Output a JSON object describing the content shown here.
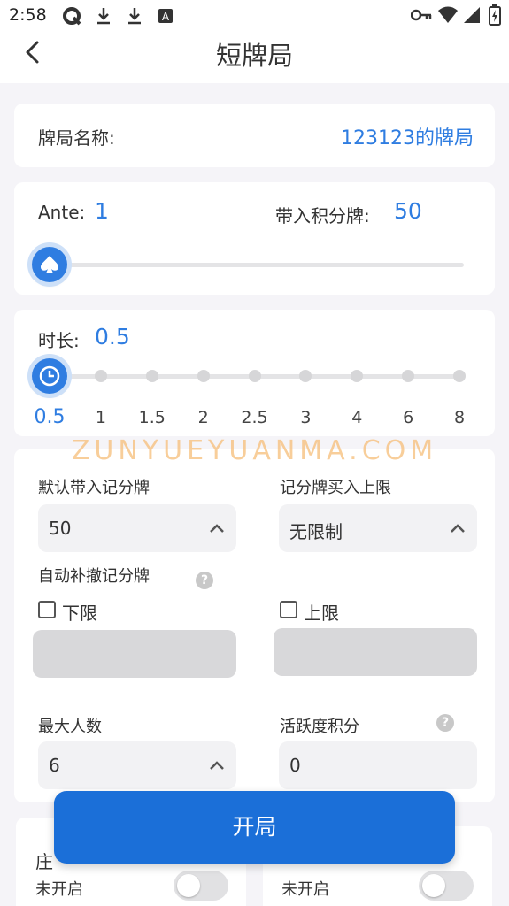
{
  "status_bar": {
    "time": "2:58",
    "icons": [
      "q-app-icon",
      "download-icon",
      "download-icon",
      "font-icon",
      "key-icon",
      "wifi-icon",
      "signal-icon",
      "battery-icon"
    ]
  },
  "header": {
    "title": "短牌局",
    "back_icon": "chevron-left-icon"
  },
  "game_name": {
    "label": "牌局名称:",
    "value": "123123的牌局"
  },
  "ante_section": {
    "ante_label": "Ante:",
    "ante_value": "1",
    "buyin_label": "带入积分牌:",
    "buyin_value": "50",
    "slider_level": 0
  },
  "duration_section": {
    "label": "时长:",
    "value": "0.5",
    "ticks": [
      "0.5",
      "1",
      "1.5",
      "2",
      "2.5",
      "3",
      "4",
      "6",
      "8"
    ],
    "selected_index": 0
  },
  "watermark": "ZUNYUEYUANMA.COM",
  "settings": {
    "default_buyin_label": "默认带入记分牌",
    "default_buyin_value": "50",
    "buy_limit_label": "记分牌买入上限",
    "buy_limit_value": "无限制",
    "auto_label": "自动补撤记分牌",
    "lower_label": "下限",
    "upper_label": "上限",
    "max_players_label": "最大人数",
    "max_players_value": "6",
    "activity_label": "活跃度积分",
    "activity_value": "0"
  },
  "bottom": {
    "left_label_partial": "庄",
    "left_status": "未开启",
    "right_status": "未开启"
  },
  "start_button": "开局",
  "colors": {
    "accent": "#2f7de1",
    "button": "#1b6fd8",
    "background": "#f5f4f8",
    "watermark": "#f5be78"
  }
}
